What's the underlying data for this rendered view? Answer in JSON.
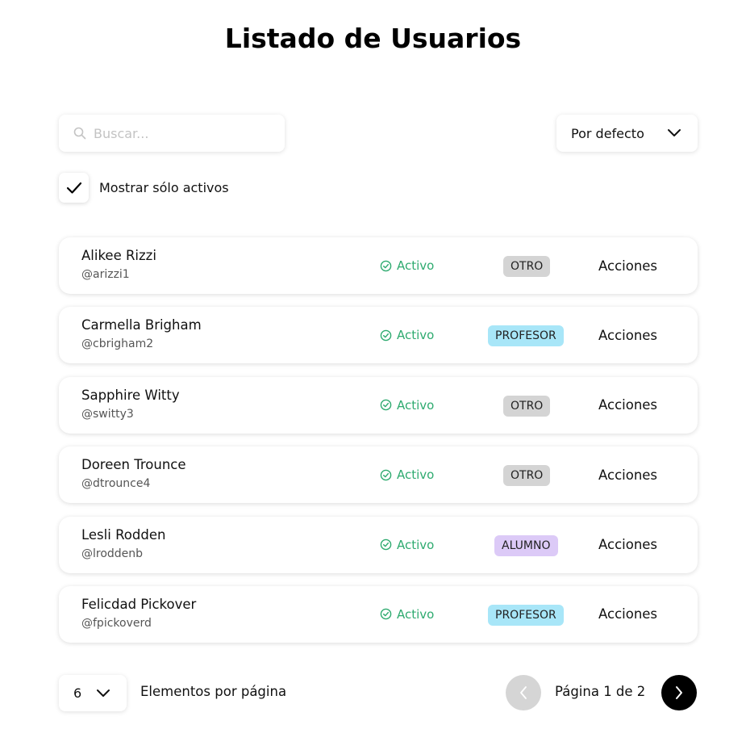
{
  "page": {
    "title": "Listado de Usuarios"
  },
  "search": {
    "placeholder": "Buscar...",
    "value": "",
    "icon": "search-icon"
  },
  "sort": {
    "selected": "Por defecto",
    "icon": "chevron-down-icon"
  },
  "filter": {
    "label": "Mostrar sólo activos",
    "checked": true,
    "icon": "checkmark-icon"
  },
  "colors": {
    "status_active": "#2eaa6f",
    "badge_otro": "#d4d4d4",
    "badge_profesor": "#a8e6f8",
    "badge_alumno": "#dccaf7",
    "next_button": "#000000",
    "prev_button_disabled": "#d5d5d5"
  },
  "users": [
    {
      "name": "Alikee Rizzi",
      "handle": "@arizzi1",
      "status": "Activo",
      "role": "OTRO",
      "actions": "Acciones"
    },
    {
      "name": "Carmella Brigham",
      "handle": "@cbrigham2",
      "status": "Activo",
      "role": "PROFESOR",
      "actions": "Acciones"
    },
    {
      "name": "Sapphire Witty",
      "handle": "@switty3",
      "status": "Activo",
      "role": "OTRO",
      "actions": "Acciones"
    },
    {
      "name": "Doreen Trounce",
      "handle": "@dtrounce4",
      "status": "Activo",
      "role": "OTRO",
      "actions": "Acciones"
    },
    {
      "name": "Lesli Rodden",
      "handle": "@lroddenb",
      "status": "Activo",
      "role": "ALUMNO",
      "actions": "Acciones"
    },
    {
      "name": "Felicdad Pickover",
      "handle": "@fpickoverd",
      "status": "Activo",
      "role": "PROFESOR",
      "actions": "Acciones"
    }
  ],
  "pagination": {
    "page_size": "6",
    "page_size_label": "Elementos por página",
    "page_indicator": "Página 1 de 2",
    "prev_icon": "chevron-left-icon",
    "next_icon": "chevron-right-icon"
  }
}
